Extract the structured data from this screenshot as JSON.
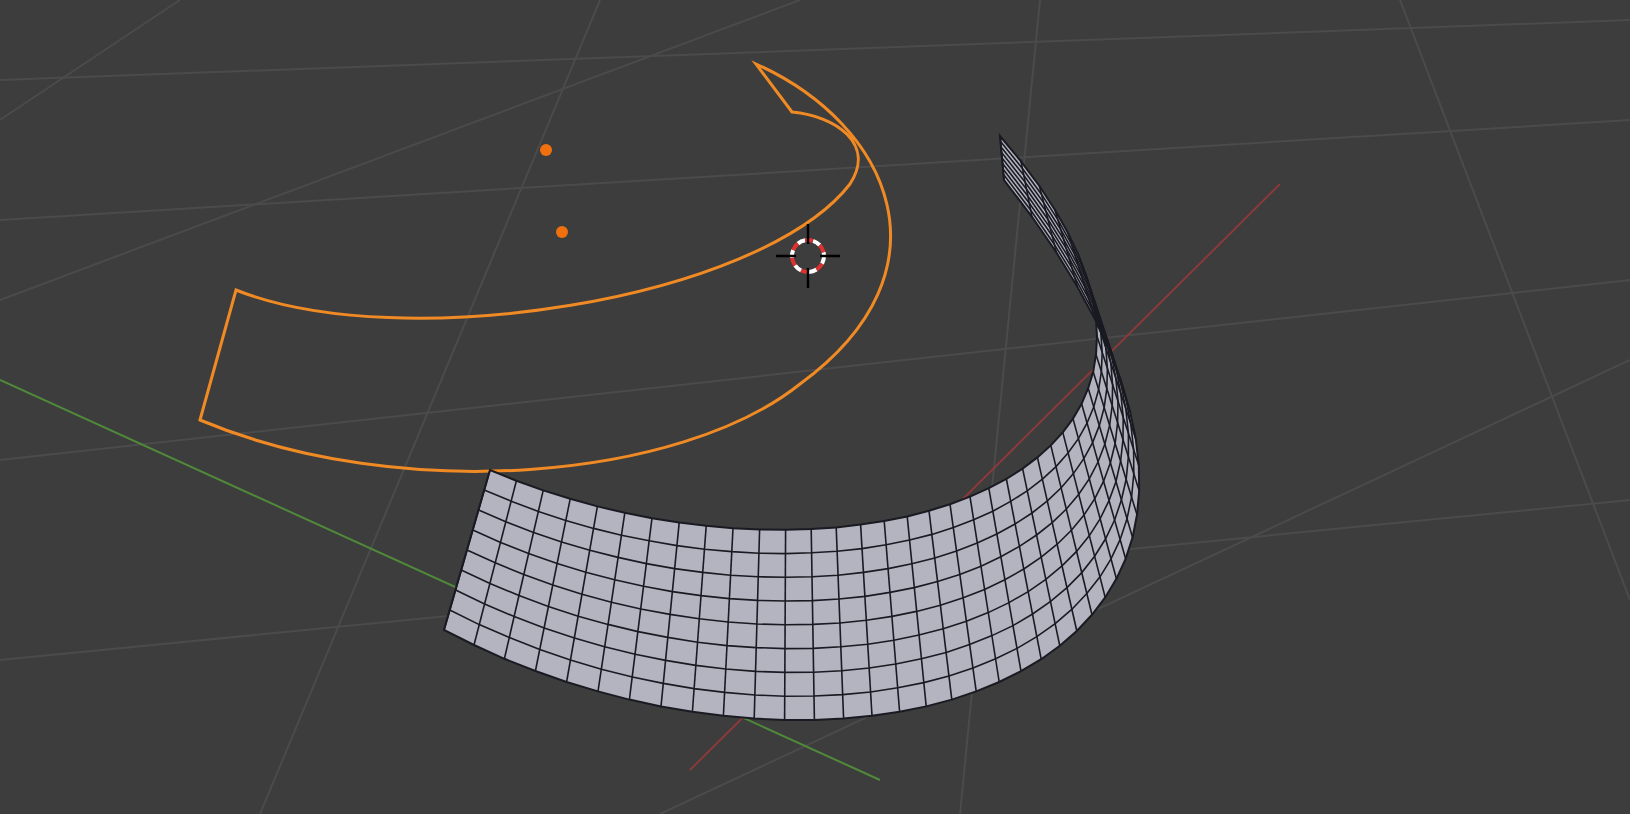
{
  "viewport": {
    "objects": [
      {
        "kind": "curve",
        "selected": true
      },
      {
        "kind": "mesh",
        "selected": false
      }
    ]
  }
}
